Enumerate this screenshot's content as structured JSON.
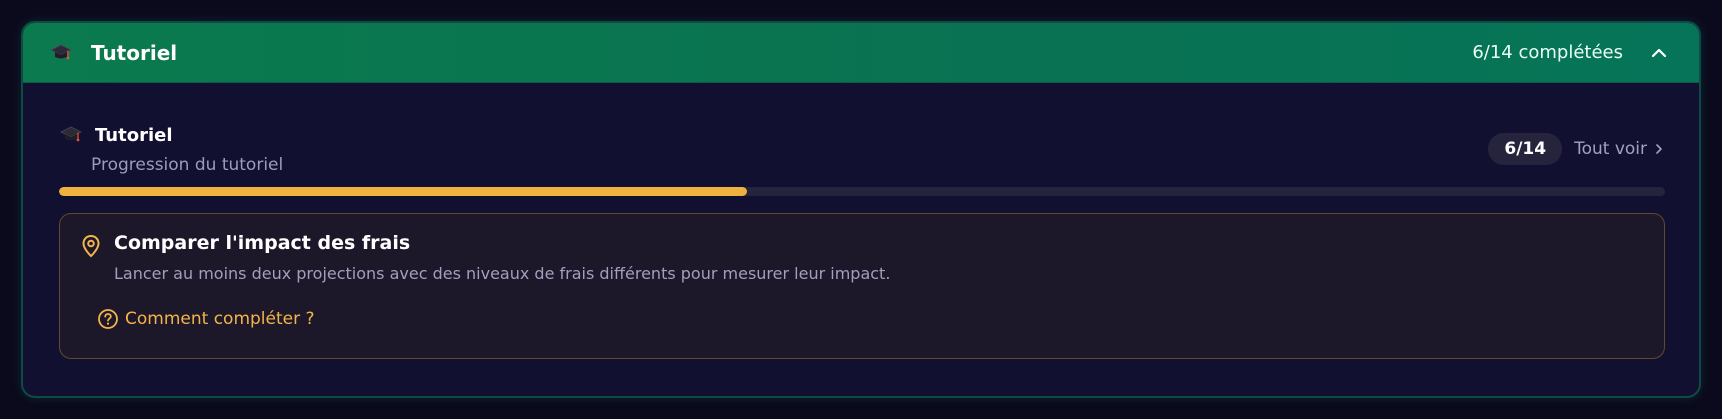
{
  "header": {
    "icon": "graduation-cap-icon",
    "title": "Tutoriel",
    "completed_text": "6/14 complétées",
    "collapse_icon": "chevron-up-icon"
  },
  "section": {
    "icon": "graduation-cap-icon",
    "title": "Tutoriel",
    "subtitle": "Progression du tutoriel",
    "count_badge": "6/14",
    "see_all_label": "Tout voir",
    "see_all_icon": "chevron-right-icon"
  },
  "progress": {
    "completed": 6,
    "total": 14,
    "fraction": 0.4286,
    "color": "#efb23e"
  },
  "task": {
    "icon": "map-pin-icon",
    "title": "Comparer l'impact des frais",
    "description": "Lancer au moins deux projections avec des niveaux de frais différents pour mesurer leur impact.",
    "howto_icon": "help-circle-icon",
    "howto_label": "Comment compléter ?"
  },
  "colors": {
    "accent": "#efb23e",
    "header_green": "#0b7a4e",
    "background": "#121030"
  }
}
